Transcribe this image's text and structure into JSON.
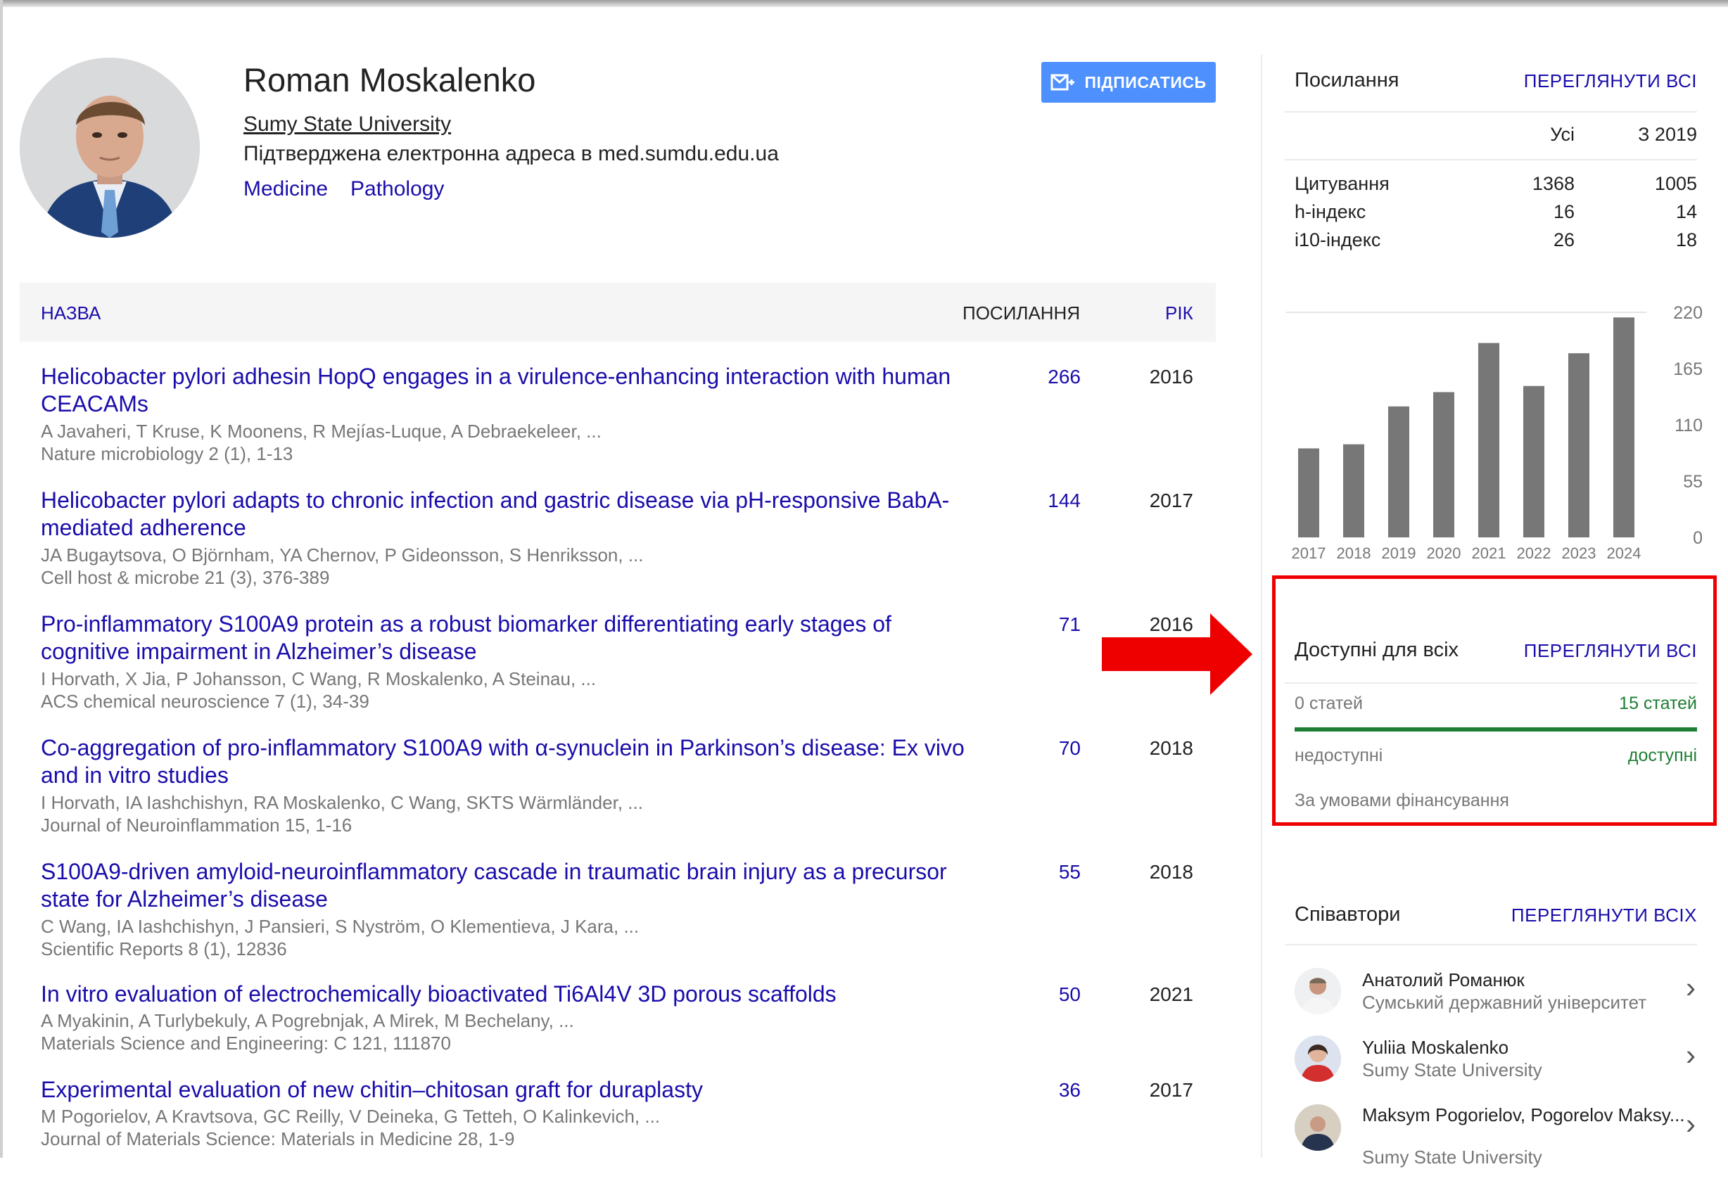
{
  "profile": {
    "name": "Roman Moskalenko",
    "affiliation": "Sumy State University",
    "email": "Підтверджена електронна адреса в med.sumdu.edu.ua",
    "tags": [
      "Medicine",
      "Pathology"
    ],
    "follow_label": "ПІДПИСАТИСЬ"
  },
  "table": {
    "headers": {
      "title": "НАЗВА",
      "cited": "ПОСИЛАННЯ",
      "year": "РІК"
    },
    "rows": [
      {
        "title": "Helicobacter pylori adhesin HopQ engages in a virulence-enhancing interaction with human CEACAMs",
        "authors": "A Javaheri, T Kruse, K Moonens, R Mejías-Luque, A Debraekeleer, ...",
        "venue": "Nature microbiology 2 (1), 1-13",
        "cited": "266",
        "year": "2016"
      },
      {
        "title": "Helicobacter pylori adapts to chronic infection and gastric disease via pH-responsive BabA-mediated adherence",
        "authors": "JA Bugaytsova, O Björnham, YA Chernov, P Gideonsson, S Henriksson, ...",
        "venue": "Cell host & microbe 21 (3), 376-389",
        "cited": "144",
        "year": "2017"
      },
      {
        "title": "Pro-inflammatory S100A9 protein as a robust biomarker differentiating early stages of cognitive impairment in Alzheimer’s disease",
        "authors": "I Horvath, X Jia, P Johansson, C Wang, R Moskalenko, A Steinau, ...",
        "venue": "ACS chemical neuroscience 7 (1), 34-39",
        "cited": "71",
        "year": "2016"
      },
      {
        "title": "Co-aggregation of pro-inflammatory S100A9 with α-synuclein in Parkinson’s disease: Ex vivo and in vitro studies",
        "authors": "I Horvath, IA Iashchishyn, RA Moskalenko, C Wang, SKTS Wärmländer, ...",
        "venue": "Journal of Neuroinflammation 15, 1-16",
        "cited": "70",
        "year": "2018"
      },
      {
        "title": "S100A9-driven amyloid-neuroinflammatory cascade in traumatic brain injury as a precursor state for Alzheimer’s disease",
        "authors": "C Wang, IA Iashchishyn, J Pansieri, S Nyström, O Klementieva, J Kara, ...",
        "venue": "Scientific Reports 8 (1), 12836",
        "cited": "55",
        "year": "2018"
      },
      {
        "title": "In vitro evaluation of electrochemically bioactivated Ti6Al4V 3D porous scaffolds",
        "authors": "A Myakinin, A Turlybekuly, A Pogrebnjak, A Mirek, M Bechelany, ...",
        "venue": "Materials Science and Engineering: C 121, 111870",
        "cited": "50",
        "year": "2021"
      },
      {
        "title": "Experimental evaluation of new chitin–chitosan graft for duraplasty",
        "authors": "M Pogorielov, A Kravtsova, GC Reilly, V Deineka, G Tetteh, O Kalinkevich, ...",
        "venue": "Journal of Materials Science: Materials in Medicine 28, 1-9",
        "cited": "36",
        "year": "2017"
      }
    ]
  },
  "citations": {
    "heading": "Посилання",
    "view_all": "ПЕРЕГЛЯНУТИ ВСІ",
    "col_all": "Усі",
    "col_since": "З 2019",
    "rows": [
      {
        "label": "Цитування",
        "all": "1368",
        "since": "1005"
      },
      {
        "label": "h-індекс",
        "all": "16",
        "since": "14"
      },
      {
        "label": "i10-індекс",
        "all": "26",
        "since": "18"
      }
    ]
  },
  "chart_data": {
    "type": "bar",
    "categories": [
      "2017",
      "2018",
      "2019",
      "2020",
      "2021",
      "2022",
      "2023",
      "2024"
    ],
    "values": [
      87,
      91,
      128,
      142,
      190,
      148,
      180,
      215
    ],
    "yticks": [
      "220",
      "165",
      "110",
      "55",
      "0"
    ],
    "ylim": [
      0,
      220
    ],
    "bar_color": "#777777"
  },
  "open_access": {
    "heading": "Доступні для всіх",
    "view_all": "ПЕРЕГЛЯНУТИ ВСІ",
    "left_count": "0 статей",
    "right_count": "15 статей",
    "left_label": "недоступні",
    "right_label": "доступні",
    "mandates": "За умовами фінансування",
    "available_fraction": 1.0,
    "accent": "#1e7e34",
    "highlight_color": "#ee0000"
  },
  "coauthors": {
    "heading": "Співавтори",
    "view_all": "ПЕРЕГЛЯНУТИ ВСІХ",
    "items": [
      {
        "name": "Анатолий Романюк",
        "affiliation": "Сумський державний університет"
      },
      {
        "name": "Yuliia Moskalenko",
        "affiliation": "Sumy State University"
      },
      {
        "name": "Maksym Pogorielov, Pogorelov Maksy...",
        "affiliation": "Sumy State University"
      }
    ]
  }
}
